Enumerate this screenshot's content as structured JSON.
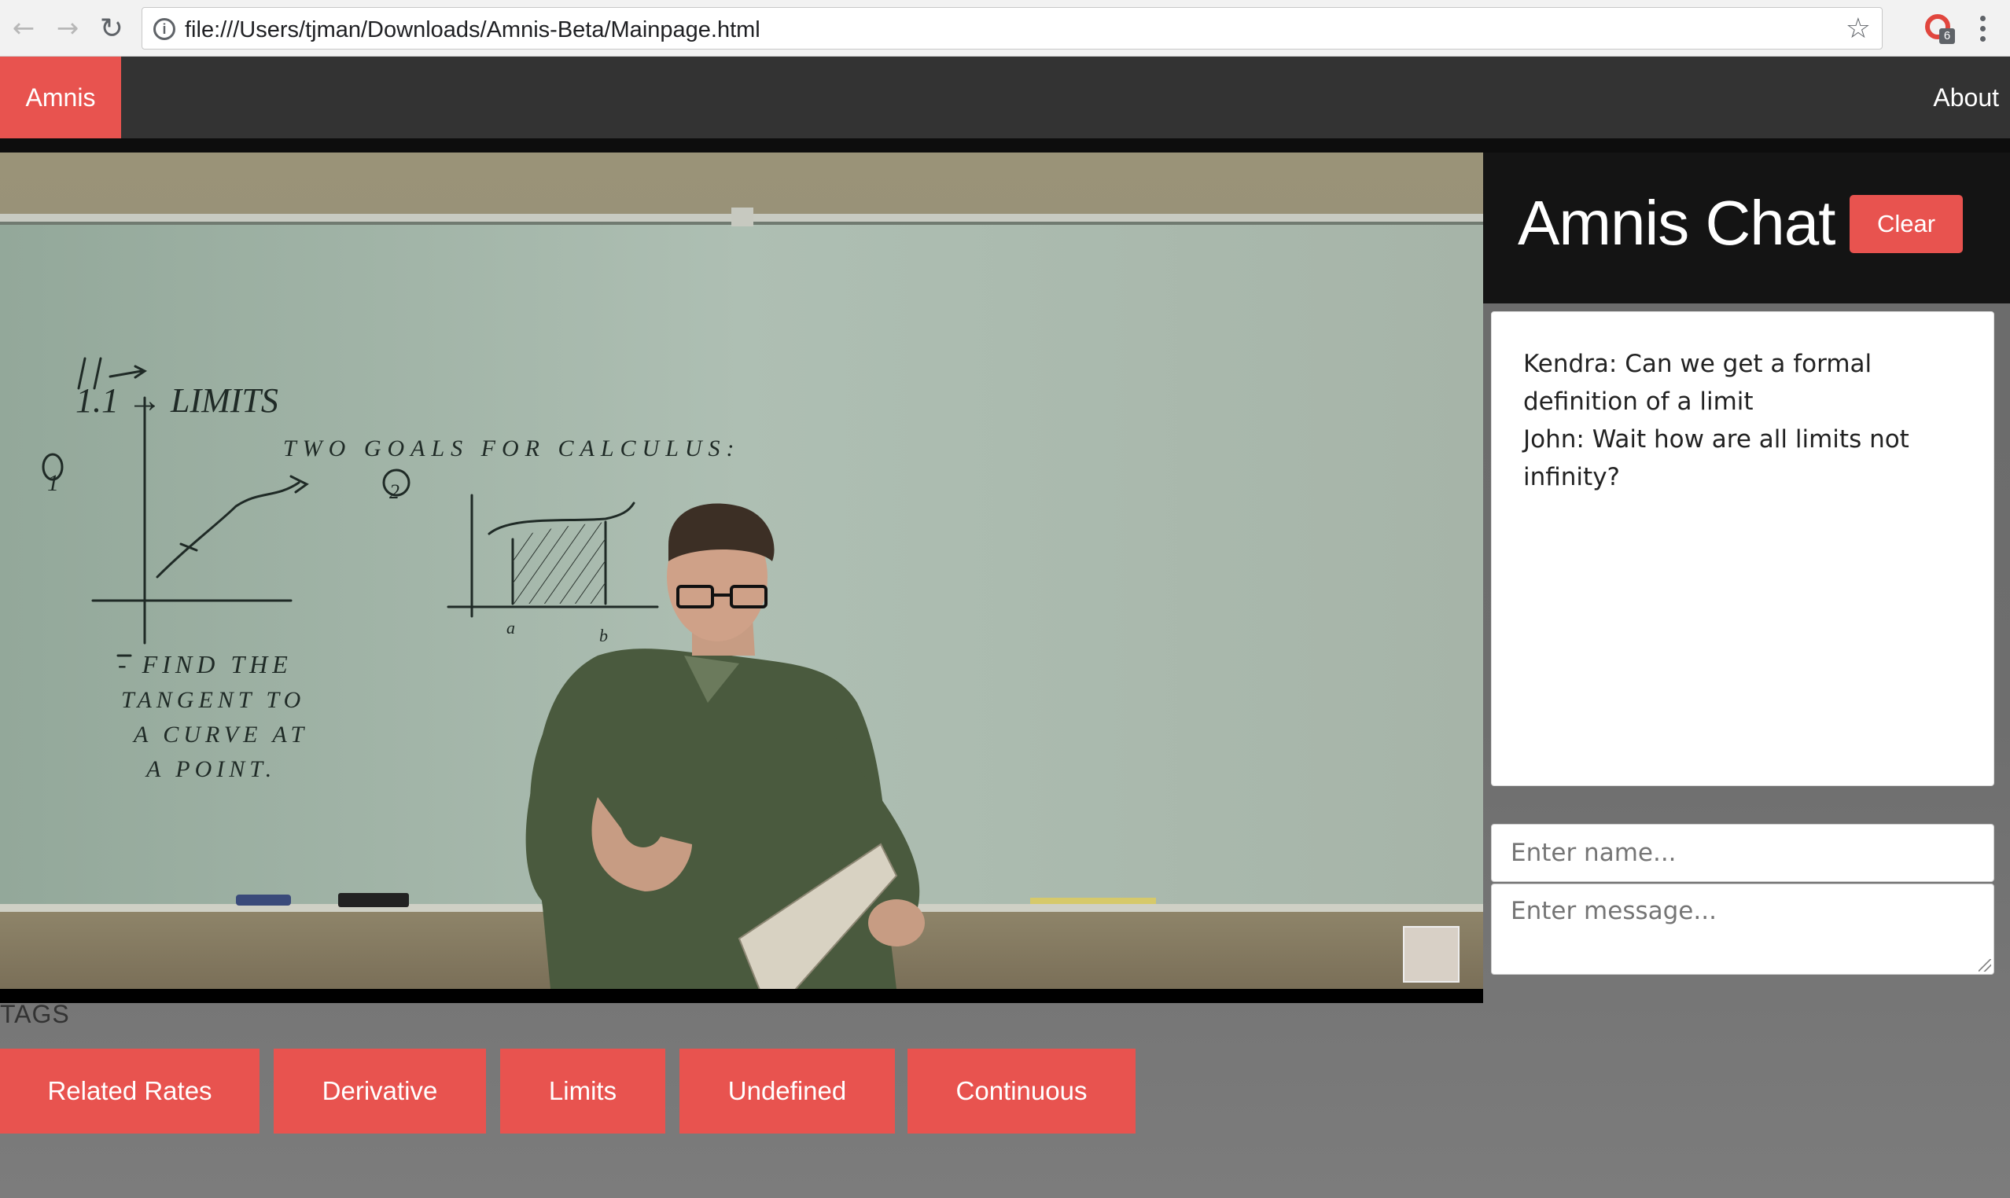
{
  "browser": {
    "url": "file:///Users/tjman/Downloads/Amnis-Beta/Mainpage.html",
    "extension_badge": "6",
    "icons": [
      "back-icon",
      "forward-icon",
      "reload-icon",
      "info-icon",
      "star-icon",
      "extension-icon",
      "menu-icon"
    ]
  },
  "navbar": {
    "brand": "Amnis",
    "about": "About"
  },
  "video": {
    "whiteboard": {
      "heading": "1.1 → LIMITS",
      "subheading": "TWO GOALS FOR CALCULUS:",
      "goal_one_marker": "1",
      "goal_two_marker": "2",
      "notes": [
        "- FIND THE",
        "TANGENT TO",
        "A CURVE AT",
        "A POINT."
      ],
      "axis_a": "a",
      "axis_b": "b"
    }
  },
  "chat": {
    "title": "Amnis Chat",
    "clear_label": "Clear",
    "messages": [
      "Kendra: Can we get a formal definition of a limit",
      "John: Wait how are all limits not infinity?"
    ],
    "name_placeholder": "Enter name...",
    "message_placeholder": "Enter message..."
  },
  "tags": {
    "label": "TAGS",
    "items": [
      "Related Rates",
      "Derivative",
      "Limits",
      "Undefined",
      "Continuous"
    ]
  },
  "colors": {
    "accent": "#e8534f",
    "navbar": "#333333",
    "chat_header": "#141414"
  }
}
